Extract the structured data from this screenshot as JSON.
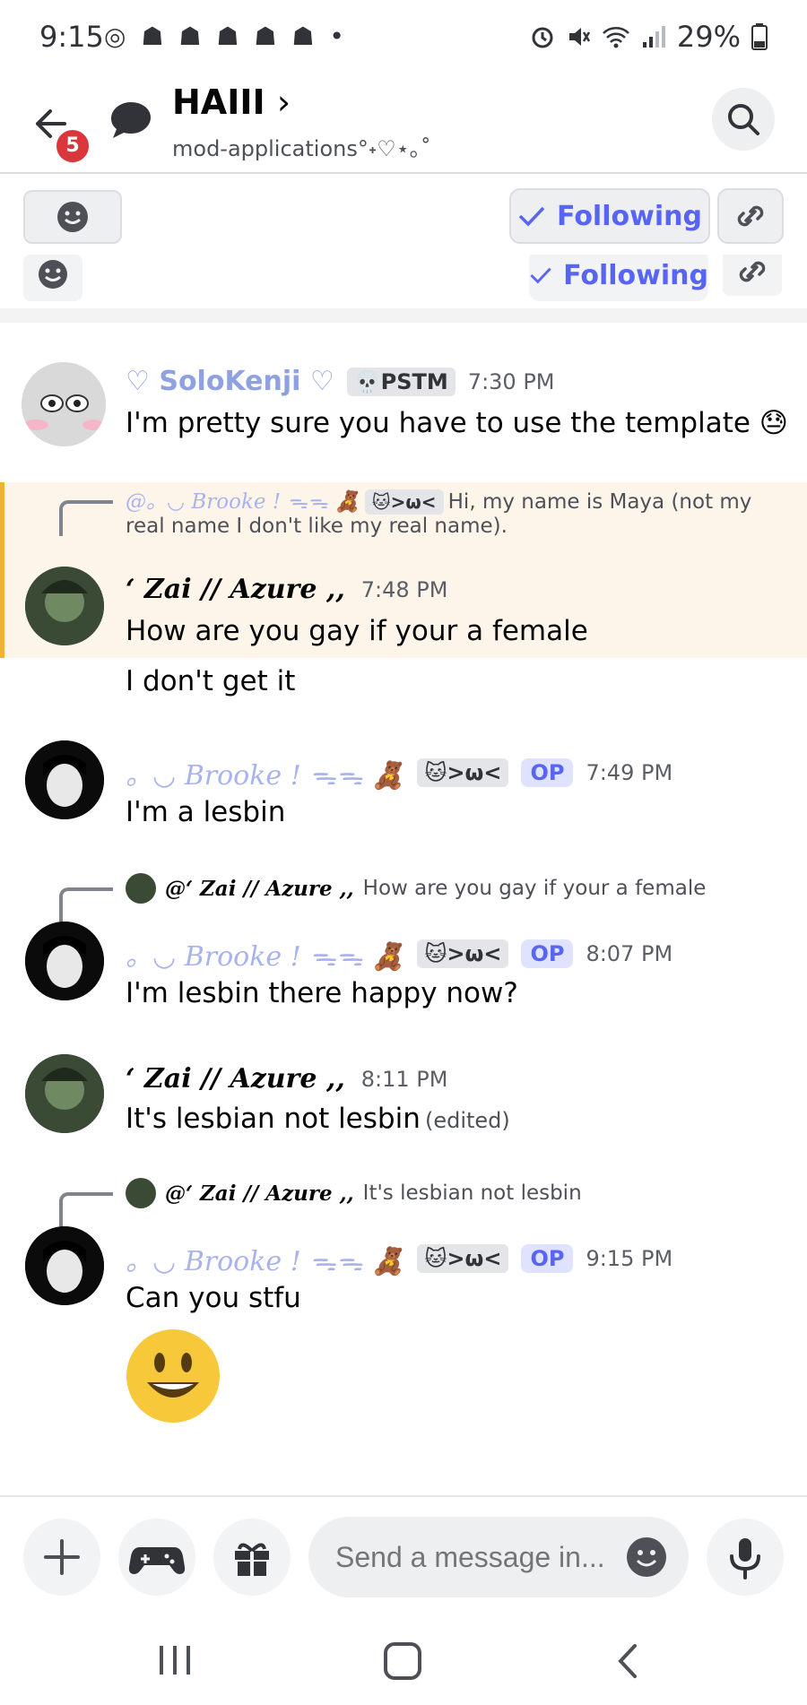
{
  "status_bar": {
    "time": "9:15",
    "left_icons": "◎ ☗ ☗ ☗ ☗ ☗ •",
    "right": "29%"
  },
  "header": {
    "badge_count": "5",
    "title": "HAIII",
    "chevron": "›",
    "subtitle": "mod-applications°˖♡⋆｡˚"
  },
  "actions": {
    "following_label": "Following",
    "following_label_2": "Following"
  },
  "messages": [
    {
      "username": "♡ SoloKenji ♡",
      "tag": "💀PSTM",
      "time": "7:30 PM",
      "text": "I'm pretty sure you have to use the template 😓"
    },
    {
      "reply_user": "@。◡ Brooke ! ᯓᯓ 🧸",
      "reply_tag": "🐱>ω<",
      "reply_text": "Hi, my name is Maya (not my",
      "reply_text_2": "real name I don't like my real name).",
      "username": "‘ Zai // Azure ,,",
      "time": "7:48 PM",
      "text": "How are you gay if your a female",
      "text_2": "I don't get it"
    },
    {
      "username": "。◡ Brooke ! ᯓᯓ 🧸",
      "tag": "🐱>ω<",
      "op": "OP",
      "time": "7:49 PM",
      "text": "I'm a lesbin"
    },
    {
      "reply_user": "@‘ Zai // Azure ,,",
      "reply_text": "How are you gay if your a female",
      "username": "。◡ Brooke ! ᯓᯓ 🧸",
      "tag": "🐱>ω<",
      "op": "OP",
      "time": "8:07 PM",
      "text": "I'm lesbin there happy now?"
    },
    {
      "username": "‘ Zai // Azure ,,",
      "time": "8:11 PM",
      "text": "It's lesbian not lesbin",
      "edited": "(edited)"
    },
    {
      "reply_user": "@‘ Zai // Azure ,,",
      "reply_text": "It's lesbian not lesbin",
      "username": "。◡ Brooke ! ᯓᯓ 🧸",
      "tag": "🐱>ω<",
      "op": "OP",
      "time": "9:15 PM",
      "text": "Can you stfu"
    }
  ],
  "composer": {
    "placeholder": "Send a message in..."
  },
  "colors": {
    "accent": "#5865f2",
    "highlight_bar": "#f0b232",
    "badge": "#da373c"
  }
}
